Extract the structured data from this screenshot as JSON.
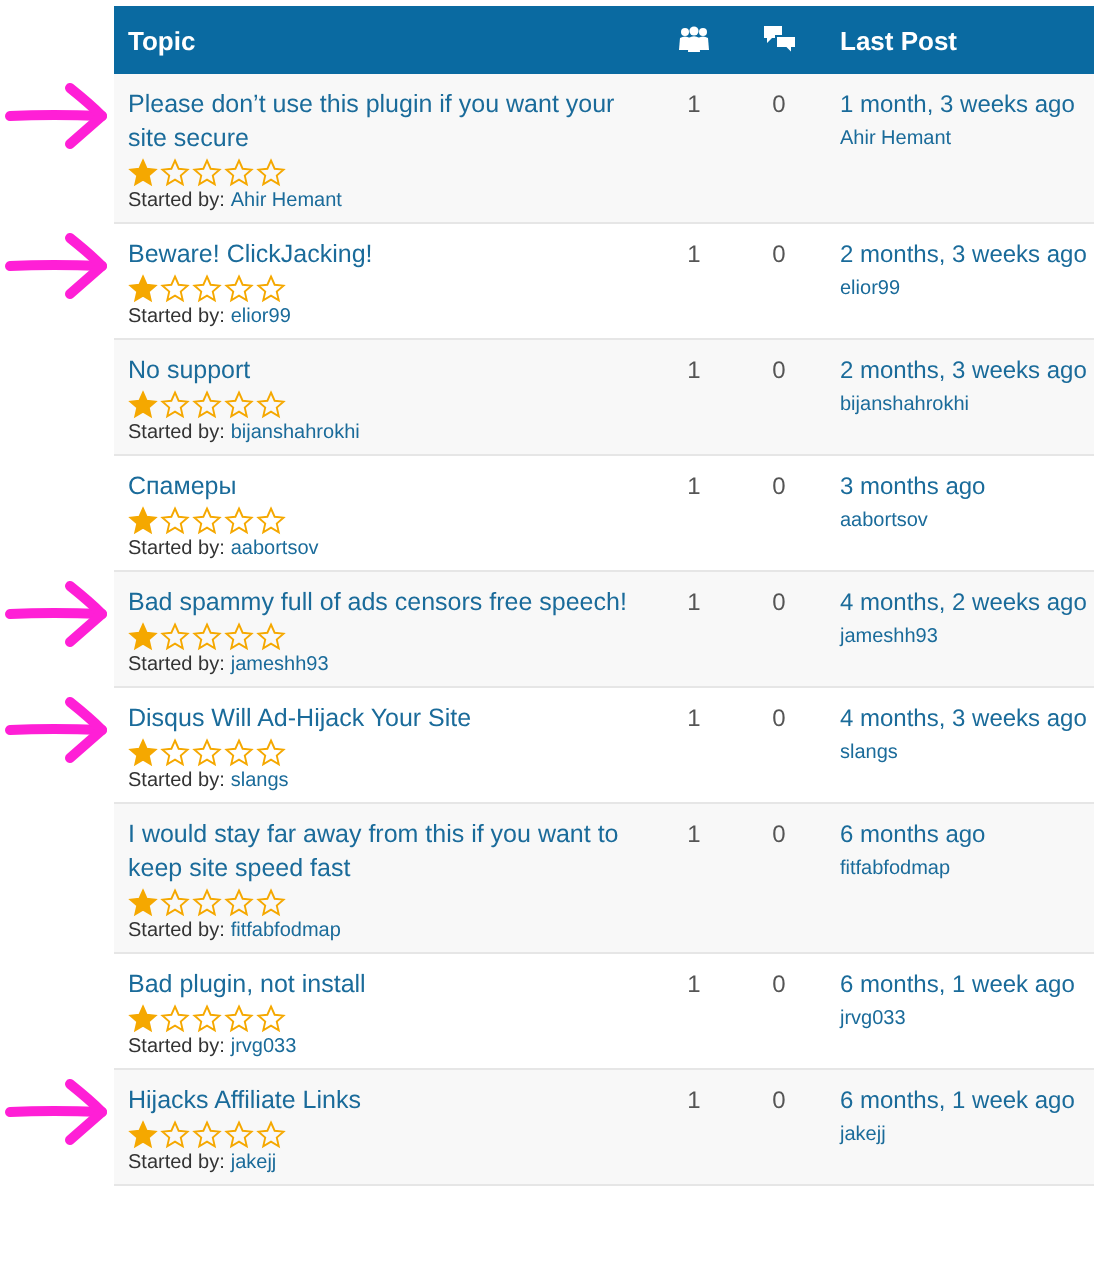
{
  "table": {
    "columns": [
      {
        "kind": "text",
        "label": "Topic"
      },
      {
        "kind": "voices"
      },
      {
        "kind": "posts"
      },
      {
        "kind": "text",
        "label": "Last Post"
      }
    ],
    "rows": [
      {
        "annotated": true,
        "title": "Please don’t use this plugin if you want your site secure",
        "stars": 1,
        "started_by_label": "Started by:",
        "author": "Ahir Hemant",
        "voices": "1",
        "posts": "0",
        "last_post": "1 month, 3 weeks ago",
        "last_author": "Ahir Hemant"
      },
      {
        "annotated": true,
        "title": "Beware! ClickJacking!",
        "stars": 1,
        "started_by_label": "Started by:",
        "author": "elior99",
        "voices": "1",
        "posts": "0",
        "last_post": "2 months, 3 weeks ago",
        "last_author": "elior99"
      },
      {
        "annotated": false,
        "title": "No support",
        "stars": 1,
        "started_by_label": "Started by:",
        "author": "bijanshahrokhi",
        "voices": "1",
        "posts": "0",
        "last_post": "2 months, 3 weeks ago",
        "last_author": "bijanshahrokhi"
      },
      {
        "annotated": false,
        "title": "Спамеры",
        "stars": 1,
        "started_by_label": "Started by:",
        "author": "aabortsov",
        "voices": "1",
        "posts": "0",
        "last_post": "3 months ago",
        "last_author": "aabortsov"
      },
      {
        "annotated": true,
        "title": "Bad spammy full of ads censors free speech!",
        "stars": 1,
        "started_by_label": "Started by:",
        "author": "jameshh93",
        "voices": "1",
        "posts": "0",
        "last_post": "4 months, 2 weeks ago",
        "last_author": "jameshh93"
      },
      {
        "annotated": true,
        "title": "Disqus Will Ad-Hijack Your Site",
        "stars": 1,
        "started_by_label": "Started by:",
        "author": "slangs",
        "voices": "1",
        "posts": "0",
        "last_post": "4 months, 3 weeks ago",
        "last_author": "slangs"
      },
      {
        "annotated": false,
        "title": "I would stay far away from this if you want to keep site speed fast",
        "stars": 1,
        "started_by_label": "Started by:",
        "author": "fitfabfodmap",
        "voices": "1",
        "posts": "0",
        "last_post": "6 months ago",
        "last_author": "fitfabfodmap"
      },
      {
        "annotated": false,
        "title": "Bad plugin, not install",
        "stars": 1,
        "started_by_label": "Started by:",
        "author": "jrvg033",
        "voices": "1",
        "posts": "0",
        "last_post": "6 months, 1 week ago",
        "last_author": "jrvg033"
      },
      {
        "annotated": true,
        "title": "Hijacks Affiliate Links",
        "stars": 1,
        "started_by_label": "Started by:",
        "author": "jakejj",
        "voices": "1",
        "posts": "0",
        "last_post": "6 months, 1 week ago",
        "last_author": "jakejj"
      }
    ]
  }
}
